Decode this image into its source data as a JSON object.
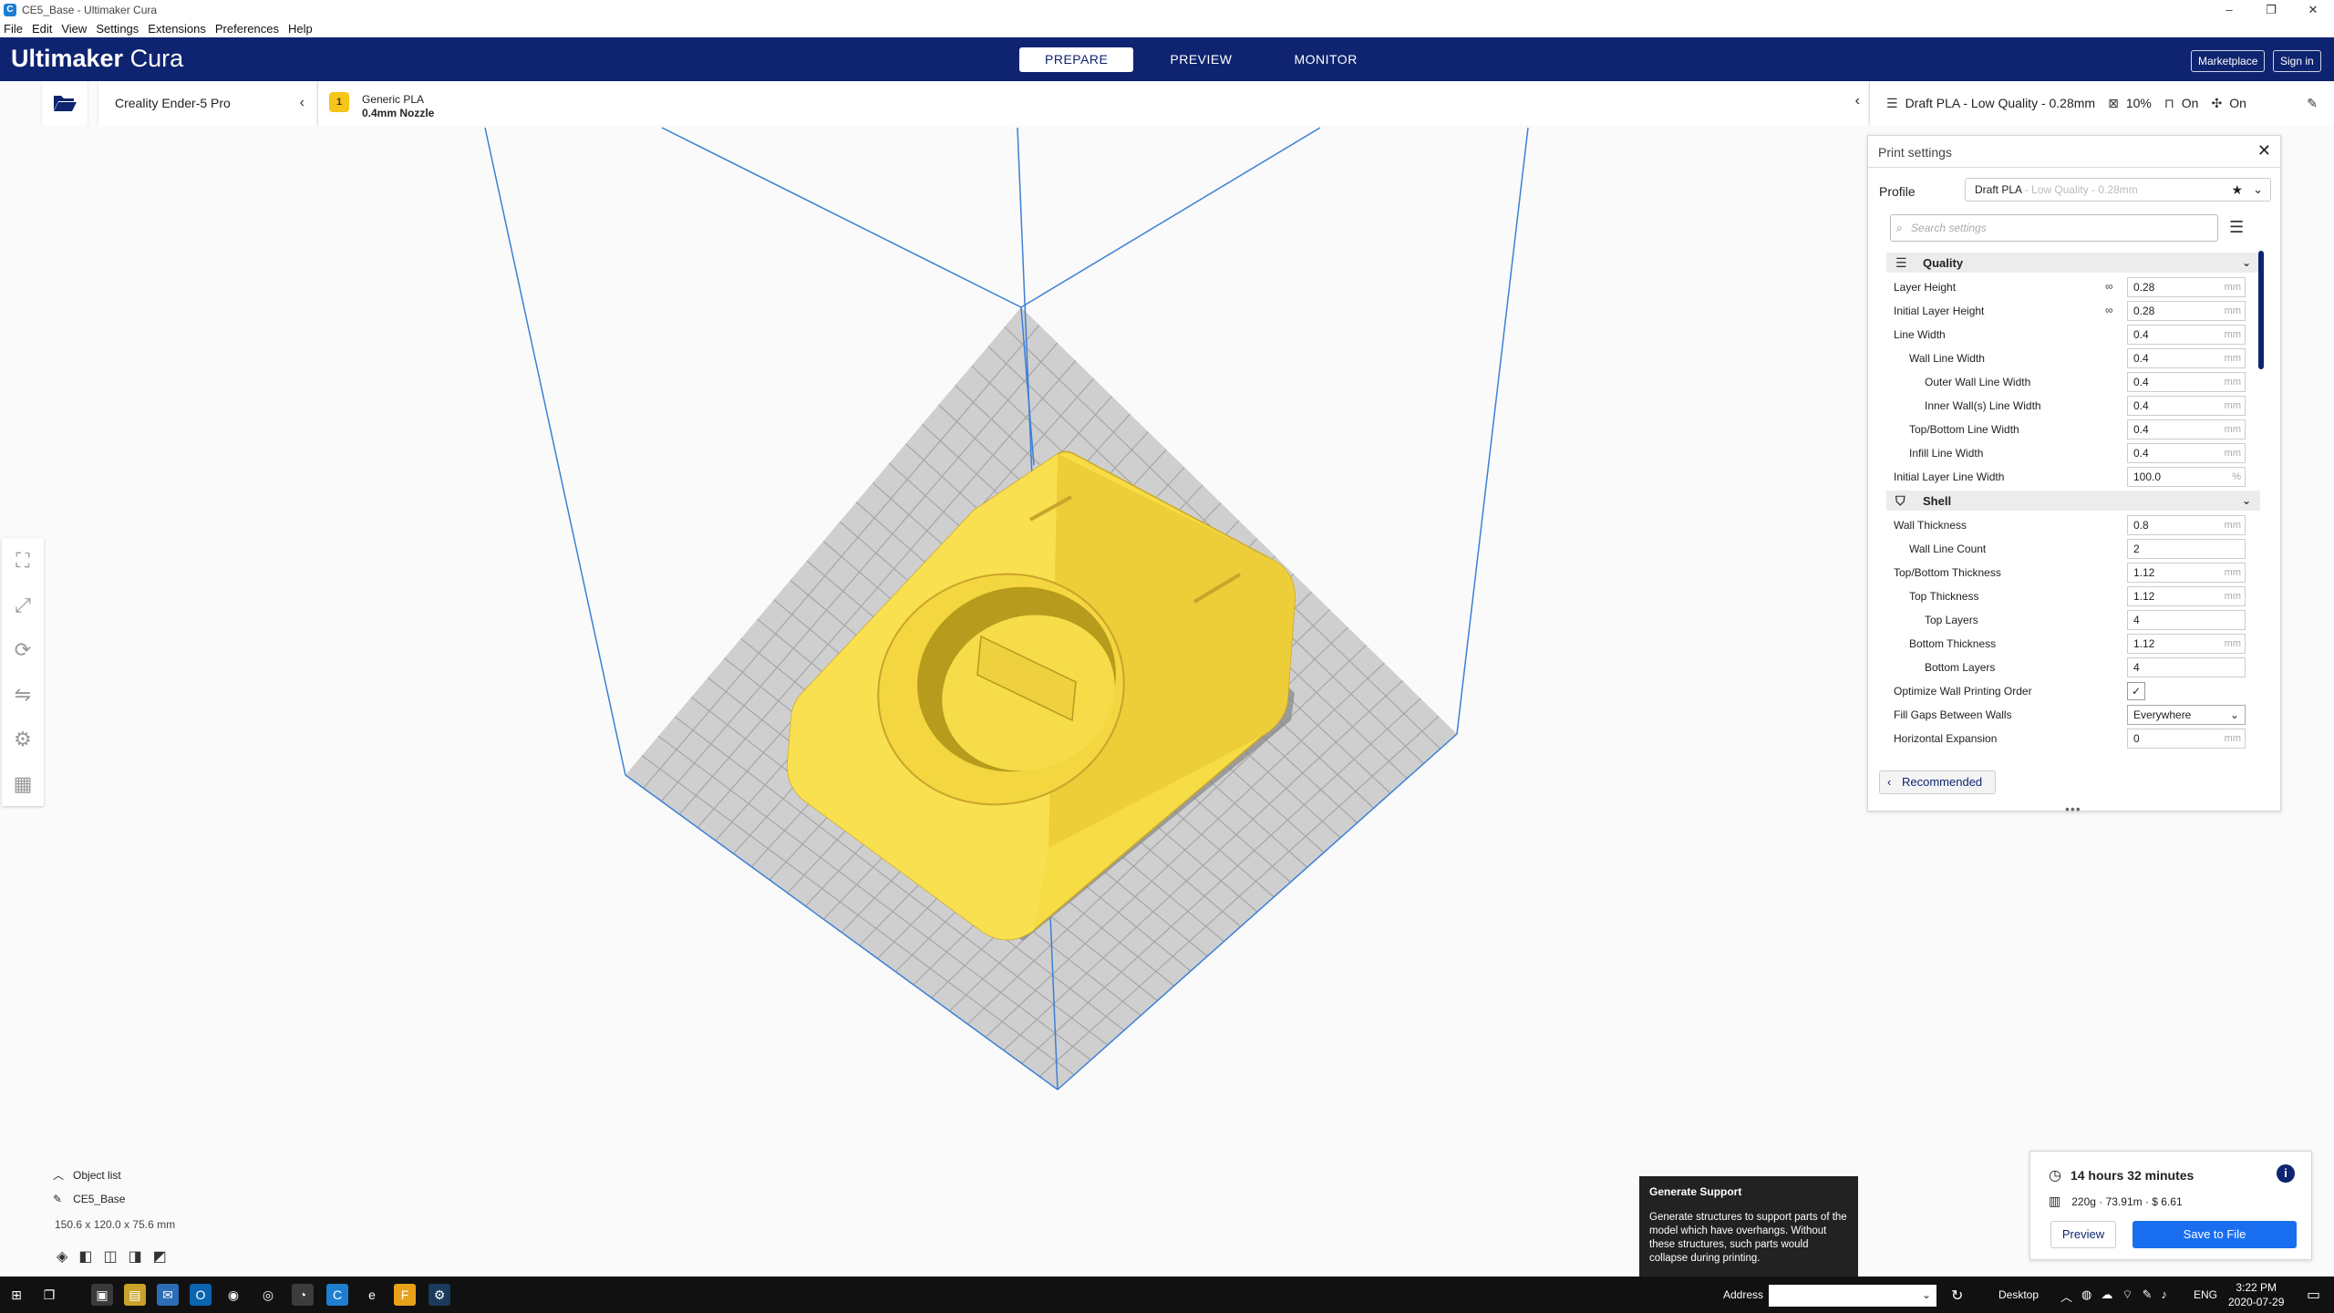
{
  "window": {
    "title": "CE5_Base - Ultimaker Cura",
    "controls": [
      "–",
      "❐",
      "✕"
    ]
  },
  "menu": [
    "File",
    "Edit",
    "View",
    "Settings",
    "Extensions",
    "Preferences",
    "Help"
  ],
  "header": {
    "logo_bold": "Ultimaker",
    "logo_light": "Cura",
    "stages": [
      {
        "label": "PREPARE",
        "active": true
      },
      {
        "label": "PREVIEW",
        "active": false
      },
      {
        "label": "MONITOR",
        "active": false
      }
    ],
    "marketplace": "Marketplace",
    "signin": "Sign in"
  },
  "printer": {
    "name": "Creality Ender-5 Pro"
  },
  "material": {
    "badge": "1",
    "name": "Generic PLA",
    "nozzle": "0.4mm Nozzle"
  },
  "settings_summary": {
    "profile": "Draft PLA - Low Quality - 0.28mm",
    "infill": "10%",
    "support": "On",
    "adhesion": "On"
  },
  "print_panel": {
    "title": "Print settings",
    "profile_label": "Profile",
    "profile_name": "Draft PLA",
    "profile_quality": " - Low Quality - 0.28mm",
    "search_placeholder": "Search settings",
    "categories": [
      {
        "name": "Quality",
        "rows": [
          {
            "label": "Layer Height",
            "indent": 0,
            "value": "0.28",
            "unit": "mm",
            "linked": true
          },
          {
            "label": "Initial Layer Height",
            "indent": 0,
            "value": "0.28",
            "unit": "mm",
            "linked": true
          },
          {
            "label": "Line Width",
            "indent": 0,
            "value": "0.4",
            "unit": "mm"
          },
          {
            "label": "Wall Line Width",
            "indent": 1,
            "value": "0.4",
            "unit": "mm"
          },
          {
            "label": "Outer Wall Line Width",
            "indent": 2,
            "value": "0.4",
            "unit": "mm"
          },
          {
            "label": "Inner Wall(s) Line Width",
            "indent": 2,
            "value": "0.4",
            "unit": "mm"
          },
          {
            "label": "Top/Bottom Line Width",
            "indent": 1,
            "value": "0.4",
            "unit": "mm"
          },
          {
            "label": "Infill Line Width",
            "indent": 1,
            "value": "0.4",
            "unit": "mm"
          },
          {
            "label": "Initial Layer Line Width",
            "indent": 0,
            "value": "100.0",
            "unit": "%"
          }
        ]
      },
      {
        "name": "Shell",
        "rows": [
          {
            "label": "Wall Thickness",
            "indent": 0,
            "value": "0.8",
            "unit": "mm"
          },
          {
            "label": "Wall Line Count",
            "indent": 1,
            "value": "2",
            "unit": ""
          },
          {
            "label": "Top/Bottom Thickness",
            "indent": 0,
            "value": "1.12",
            "unit": "mm"
          },
          {
            "label": "Top Thickness",
            "indent": 1,
            "value": "1.12",
            "unit": "mm"
          },
          {
            "label": "Top Layers",
            "indent": 2,
            "value": "4",
            "unit": ""
          },
          {
            "label": "Bottom Thickness",
            "indent": 1,
            "value": "1.12",
            "unit": "mm"
          },
          {
            "label": "Bottom Layers",
            "indent": 2,
            "value": "4",
            "unit": ""
          },
          {
            "label": "Optimize Wall Printing Order",
            "indent": 0,
            "type": "checkbox",
            "checked": true
          },
          {
            "label": "Fill Gaps Between Walls",
            "indent": 0,
            "type": "dropdown",
            "value": "Everywhere"
          },
          {
            "label": "Horizontal Expansion",
            "indent": 0,
            "value": "0",
            "unit": "mm"
          }
        ]
      }
    ],
    "recommended": "Recommended"
  },
  "object_list": {
    "title": "Object list",
    "object_name": "CE5_Base",
    "dimensions": "150.6 x 120.0 x 75.6 mm"
  },
  "tooltip": {
    "title": "Generate Support",
    "body": "Generate structures to support parts of the model which have overhangs. Without these structures, such parts would collapse during printing."
  },
  "estimate": {
    "time": "14 hours 32 minutes",
    "material": "220g · 73.91m · $ 6.61",
    "preview": "Preview",
    "save": "Save to File"
  },
  "taskbar": {
    "address_label": "Address",
    "desktop_label": "Desktop",
    "language": "ENG",
    "time": "3:22 PM",
    "date": "2020-07-29"
  },
  "colors": {
    "header": "#0f2470",
    "model": "#f6dc45",
    "accent": "#196ef0"
  }
}
